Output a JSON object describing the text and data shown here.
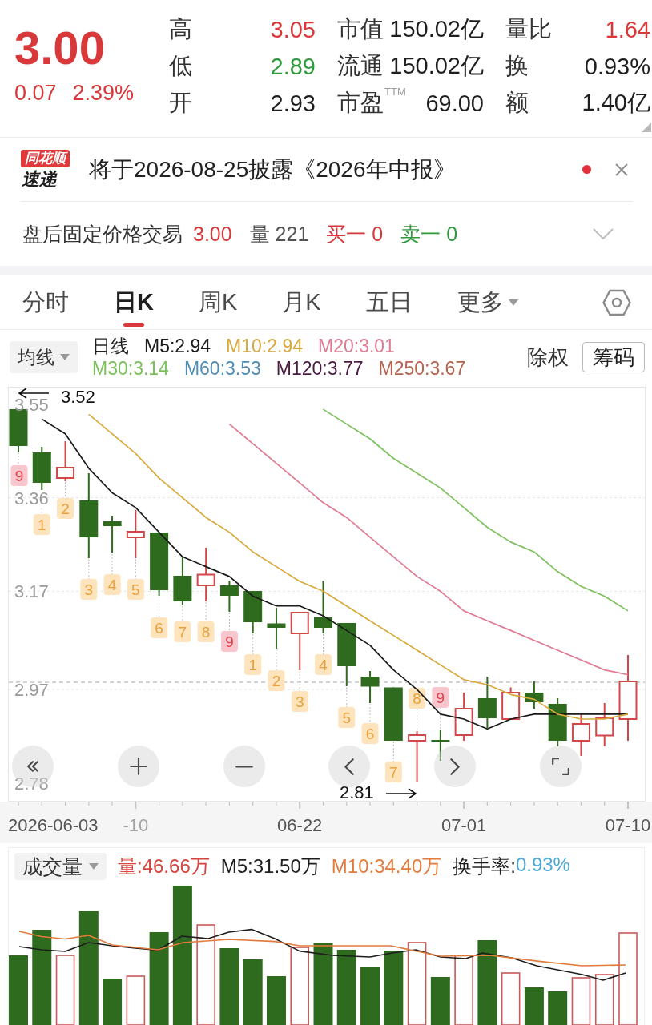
{
  "quote": {
    "price": "3.00",
    "change": "0.07",
    "change_percent": "2.39%",
    "rising": true
  },
  "stats": [
    {
      "cells": [
        {
          "label": "高",
          "value": "3.05",
          "color": "#d8383a"
        },
        {
          "label": "市值",
          "value": "150.02亿",
          "color": "#1e1e1e"
        },
        {
          "label": "量比",
          "value": "1.64",
          "color": "#d8383a"
        }
      ]
    },
    {
      "cells": [
        {
          "label": "低",
          "value": "2.89",
          "color": "#2f9a3c"
        },
        {
          "label": "流通",
          "value": "150.02亿",
          "color": "#1e1e1e"
        },
        {
          "label": "换",
          "value": "0.93%",
          "color": "#1e1e1e"
        }
      ]
    },
    {
      "cells": [
        {
          "label": "开",
          "value": "2.93",
          "color": "#1e1e1e"
        },
        {
          "label": "市盈$^{TTM}$",
          "value": "69.00",
          "color": "#1e1e1e"
        },
        {
          "label": "额",
          "value": "1.40亿",
          "color": "#1e1e1e"
        }
      ]
    }
  ],
  "notice": {
    "brand": "同花顺",
    "brand_caption": "速递",
    "text": "将于2026-08-25披露《2026年中报》",
    "unread": true
  },
  "after_hours": {
    "title": "盘后固定价格交易",
    "items": [
      {
        "text": "3.00",
        "color": "#d8383a"
      },
      {
        "text": "量 221",
        "color": "#555555"
      },
      {
        "text": "买一 0",
        "color": "#d8383a"
      },
      {
        "text": "卖一 0",
        "color": "#2f9a3c"
      }
    ]
  },
  "tabs": [
    {
      "label": "分时",
      "selected": false,
      "dropdown": false
    },
    {
      "label": "日K",
      "selected": true,
      "dropdown": false
    },
    {
      "label": "周K",
      "selected": false,
      "dropdown": false
    },
    {
      "label": "月K",
      "selected": false,
      "dropdown": false
    },
    {
      "label": "五日",
      "selected": false,
      "dropdown": false
    },
    {
      "label": "更多",
      "selected": false,
      "dropdown": true
    }
  ],
  "legend": {
    "selector": "均线",
    "period": "日线",
    "items": [
      {
        "text": "M5:2.94",
        "color": "#1a1a1a"
      },
      {
        "text": "M10:2.94",
        "color": "#d9a93c"
      },
      {
        "text": "M20:3.01",
        "color": "#e07a92"
      },
      {
        "text": "M30:3.14",
        "color": "#7cc05c"
      },
      {
        "text": "M60:3.53",
        "color": "#4f8db5"
      },
      {
        "text": "M120:3.77",
        "color": "#4a1c44"
      },
      {
        "text": "M250:3.67",
        "color": "#b56450"
      }
    ],
    "adjust": "除权",
    "chips_button": "筹码"
  },
  "price_chart": {
    "high_marker": "3.52",
    "low_marker": "2.81",
    "start_date": "2026-06-03",
    "chart_data": {
      "type": "line",
      "categories": [
        null,
        null,
        null,
        null,
        null,
        "-10",
        null,
        null,
        null,
        null,
        null,
        null,
        "06-22",
        null,
        null,
        null,
        null,
        null,
        null,
        "07-01",
        null,
        null,
        null,
        null,
        null,
        null,
        "07-10"
      ],
      "ylim": [
        2.743,
        3.585
      ],
      "yticks": [
        3.55,
        3.36,
        3.17,
        2.97,
        2.78
      ],
      "series": [
        {
          "color": "#1a1a1a",
          "values": [
            null,
            3.52,
            3.49,
            3.42,
            3.37,
            3.34,
            3.29,
            3.24,
            3.22,
            3.2,
            3.16,
            3.14,
            3.14,
            3.12,
            3.09,
            3.06,
            3.01,
            2.97,
            2.92,
            2.91,
            2.89,
            2.91,
            2.92,
            2.92,
            2.92,
            2.92,
            2.92
          ]
        },
        {
          "color": "#d9a93c",
          "values": [
            null,
            null,
            null,
            3.53,
            3.49,
            3.45,
            3.4,
            3.36,
            3.32,
            3.29,
            3.25,
            3.22,
            3.19,
            3.17,
            3.14,
            3.11,
            3.08,
            3.05,
            3.02,
            2.99,
            2.98,
            2.96,
            2.95,
            2.92,
            2.91,
            2.91,
            2.92
          ]
        },
        {
          "color": "#e07a92",
          "values": [
            null,
            null,
            null,
            null,
            null,
            null,
            null,
            null,
            null,
            3.51,
            3.47,
            3.43,
            3.39,
            3.35,
            3.32,
            3.28,
            3.24,
            3.2,
            3.17,
            3.13,
            3.11,
            3.09,
            3.07,
            3.05,
            3.03,
            3.01,
            3.0
          ]
        },
        {
          "color": "#7cc05c",
          "values": [
            null,
            null,
            null,
            null,
            null,
            null,
            null,
            null,
            null,
            null,
            null,
            null,
            null,
            3.54,
            3.51,
            3.48,
            3.44,
            3.41,
            3.38,
            3.34,
            3.3,
            3.27,
            3.25,
            3.21,
            3.18,
            3.16,
            3.13
          ]
        }
      ]
    },
    "candles": [
      {
        "rising": false,
        "count": "9",
        "highlight": true
      },
      {
        "rising": false,
        "count": "1",
        "highlight": false
      },
      {
        "rising": true,
        "count": "2",
        "highlight": false
      },
      {
        "rising": false,
        "count": "3",
        "highlight": false
      },
      {
        "rising": false,
        "count": "4",
        "highlight": false
      },
      {
        "rising": true,
        "count": "5",
        "highlight": false
      },
      {
        "rising": false,
        "count": "6",
        "highlight": false
      },
      {
        "rising": false,
        "count": "7",
        "highlight": false
      },
      {
        "rising": true,
        "count": "8",
        "highlight": false
      },
      {
        "rising": false,
        "count": "9",
        "highlight": true
      },
      {
        "rising": false,
        "count": "1",
        "highlight": false
      },
      {
        "rising": false,
        "count": "2",
        "highlight": false
      },
      {
        "rising": true,
        "count": "3",
        "highlight": false
      },
      {
        "rising": false,
        "count": "4",
        "highlight": false
      },
      {
        "rising": false,
        "count": "5",
        "highlight": false
      },
      {
        "rising": false,
        "count": "6",
        "highlight": false
      },
      {
        "rising": false,
        "count": "7",
        "highlight": false
      },
      {
        "rising": true,
        "count": "8",
        "highlight": false
      },
      {
        "rising": false,
        "count": "9",
        "highlight": true
      },
      {
        "rising": true
      },
      {
        "rising": false
      },
      {
        "rising": true
      },
      {
        "rising": false
      },
      {
        "rising": false
      },
      {
        "rising": true
      },
      {
        "rising": true
      },
      {
        "rising": true
      }
    ]
  },
  "volume_panel": {
    "selector": "成交量",
    "items": [
      {
        "text": "量:46.66万",
        "color": "#d6453f"
      },
      {
        "text": "M5:31.50万",
        "color": "#1e1e1e"
      },
      {
        "text": "M10:34.40万",
        "color": "#e27b3e"
      }
    ],
    "turnover_label": "换手率:",
    "turnover_value": "0.93%"
  }
}
